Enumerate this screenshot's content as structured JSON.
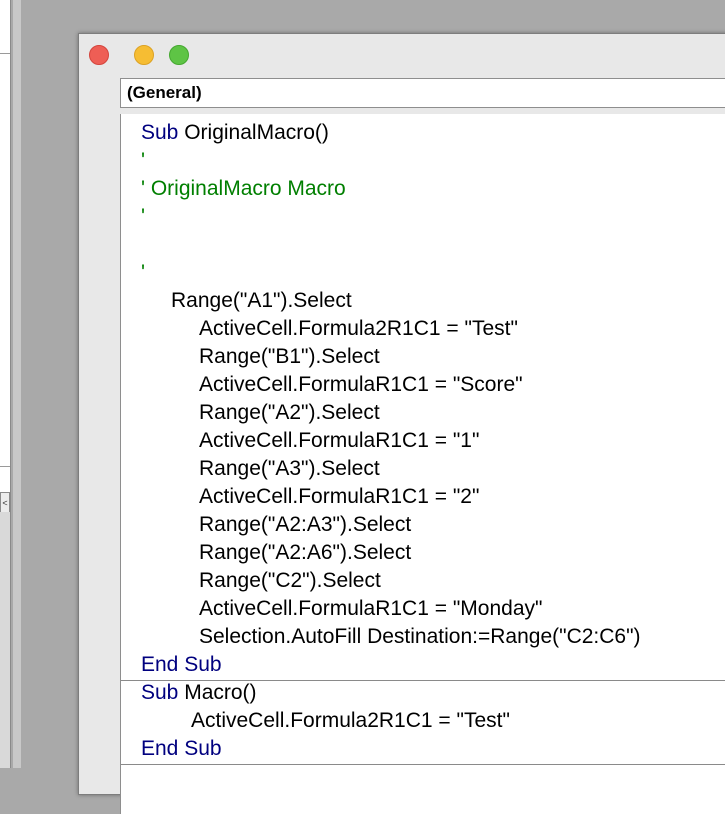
{
  "colors": {
    "keyword": "#00007f",
    "comment": "#007f00",
    "text": "#000000",
    "close": "#ee5e55",
    "minimize": "#f6bd33",
    "zoom": "#5ec445"
  },
  "window": {
    "buttons": [
      "close",
      "minimize",
      "zoom"
    ]
  },
  "object_dropdown": {
    "value": "(General)"
  },
  "left_pane": {
    "scroll_arrow": "<"
  },
  "code": {
    "line1_kw": "Sub",
    "line1_rest": " OriginalMacro()",
    "line2": "'",
    "line3": "' OriginalMacro Macro",
    "line4": "'",
    "line5": "",
    "line6": "'",
    "line7": "Range(\"A1\").Select",
    "line8": "ActiveCell.Formula2R1C1 = \"Test\"",
    "line9": "Range(\"B1\").Select",
    "line10": "ActiveCell.FormulaR1C1 = \"Score\"",
    "line11": "Range(\"A2\").Select",
    "line12": "ActiveCell.FormulaR1C1 = \"1\"",
    "line13": "Range(\"A3\").Select",
    "line14": "ActiveCell.FormulaR1C1 = \"2\"",
    "line15": "Range(\"A2:A3\").Select",
    "line16": "Range(\"A2:A6\").Select",
    "line17": "Range(\"C2\").Select",
    "line18": "ActiveCell.FormulaR1C1 = \"Monday\"",
    "line19": "Selection.AutoFill Destination:=Range(\"C2:C6\")",
    "line20": "End Sub",
    "line21_kw": "Sub",
    "line21_rest": " Macro()",
    "line22": "ActiveCell.Formula2R1C1 = \"Test\"",
    "line23": "End Sub"
  }
}
